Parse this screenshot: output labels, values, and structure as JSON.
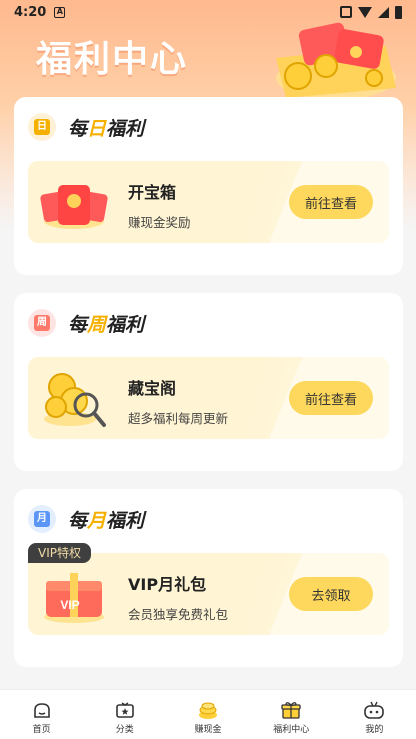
{
  "status_bar": {
    "time": "4:20",
    "a_icon": "A"
  },
  "header": {
    "title": "福利中心"
  },
  "sections": [
    {
      "badge_char": "日",
      "title_prefix": "每",
      "title_highlight": "日",
      "title_suffix": "福利",
      "item": {
        "title": "开宝箱",
        "subtitle": "赚现金奖励",
        "button": "前往查看"
      }
    },
    {
      "badge_char": "周",
      "title_prefix": "每",
      "title_highlight": "周",
      "title_suffix": "福利",
      "item": {
        "title": "藏宝阁",
        "subtitle": "超多福利每周更新",
        "button": "前往查看"
      }
    },
    {
      "badge_char": "月",
      "title_prefix": "每",
      "title_highlight": "月",
      "title_suffix": "福利",
      "tag": "VIP特权",
      "item": {
        "title": "VIP月礼包",
        "subtitle": "会员独享免费礼包",
        "button": "去领取",
        "art_text": "VIP"
      }
    }
  ],
  "bottom_nav": [
    {
      "label": "首页",
      "icon": "home-icon"
    },
    {
      "label": "分类",
      "icon": "category-icon"
    },
    {
      "label": "赚现金",
      "icon": "earn-cash-icon"
    },
    {
      "label": "福利中心",
      "icon": "gift-icon"
    },
    {
      "label": "我的",
      "icon": "profile-icon"
    }
  ],
  "colors": {
    "accent": "#fdd85c",
    "highlight": "#f6b100",
    "header": "#ffb98e"
  }
}
